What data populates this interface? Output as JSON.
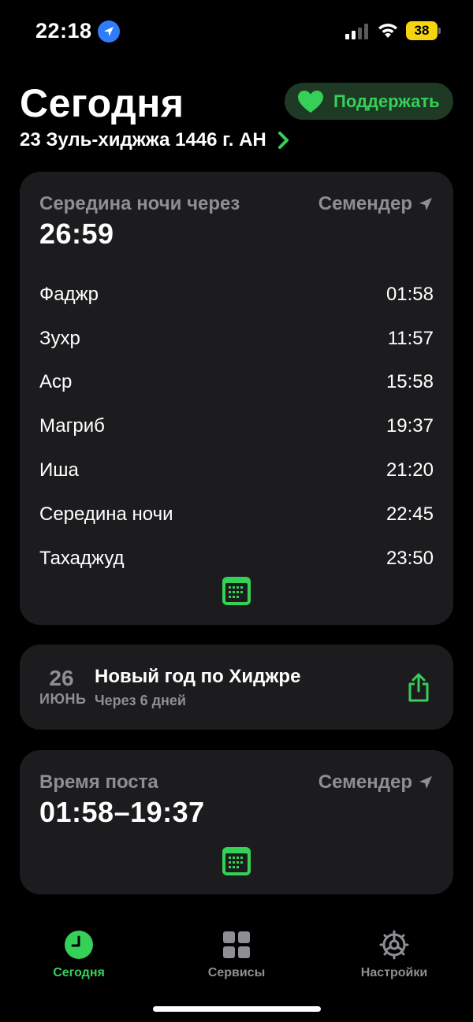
{
  "status_bar": {
    "time": "22:18",
    "battery": "38",
    "location_icon": "location-arrow-icon",
    "signal_icon": "cellular-signal-icon",
    "wifi_icon": "wifi-icon"
  },
  "header": {
    "title": "Сегодня",
    "support_label": "Поддержать",
    "support_icon": "heart-icon",
    "hijri_date": "23 Зуль-хиджжа 1446 г. AH"
  },
  "prayer_card": {
    "next_label": "Середина ночи через",
    "countdown": "26:59",
    "location": "Семендер",
    "prayers": [
      {
        "name": "Фаджр",
        "time": "01:58"
      },
      {
        "name": "Зухр",
        "time": "11:57"
      },
      {
        "name": "Аср",
        "time": "15:58"
      },
      {
        "name": "Магриб",
        "time": "19:37"
      },
      {
        "name": "Иша",
        "time": "21:20"
      },
      {
        "name": "Середина ночи",
        "time": "22:45"
      },
      {
        "name": "Тахаджуд",
        "time": "23:50"
      }
    ]
  },
  "event_card": {
    "day": "26",
    "month": "ИЮНЬ",
    "title": "Новый год по Хиджре",
    "subtitle": "Через 6 дней"
  },
  "fast_card": {
    "label": "Время поста",
    "range": "01:58–19:37",
    "location": "Семендер"
  },
  "tabs": [
    {
      "label": "Сегодня",
      "icon": "clock-icon",
      "active": true
    },
    {
      "label": "Сервисы",
      "icon": "grid-icon",
      "active": false
    },
    {
      "label": "Настройки",
      "icon": "gear-icon",
      "active": false
    }
  ],
  "colors": {
    "accent": "#34d058",
    "card_bg": "#1c1c1e",
    "secondary_text": "#8e8e93",
    "battery": "#f5d60e"
  }
}
